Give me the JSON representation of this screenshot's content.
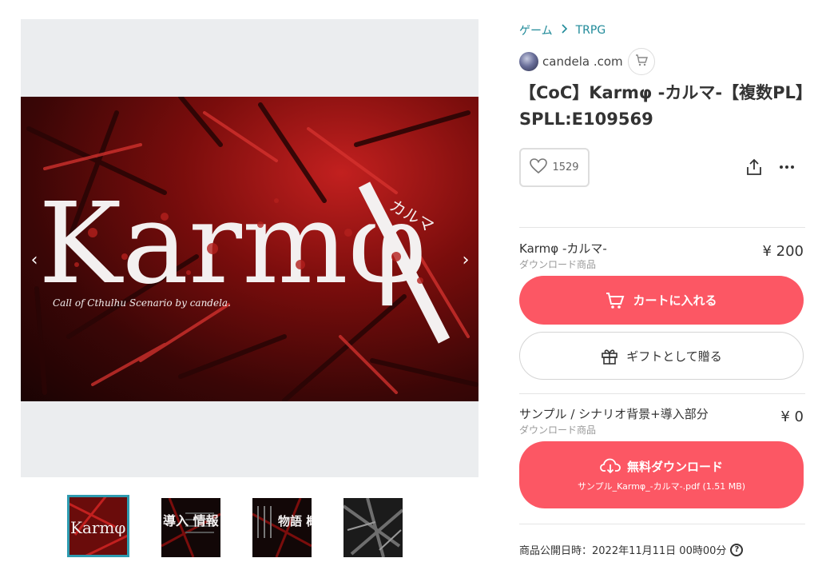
{
  "breadcrumb": {
    "category": "ゲーム",
    "subcategory": "TRPG"
  },
  "shop": {
    "name": "candela .com",
    "icon": "cart-icon"
  },
  "product": {
    "title": "【CoC】Karmφ -カルマ-【複数PL】SPLL:E109569",
    "likes": "1529"
  },
  "hero": {
    "logo_text": "Karmφ",
    "kana": "カルマ",
    "subtitle": "Call of Cthulhu Scenario by candela."
  },
  "gallery": {
    "prev_icon": "chevron-left-icon",
    "next_icon": "chevron-right-icon",
    "thumbnails": [
      {
        "caption": "Karmφ"
      },
      {
        "caption": "導入 情報"
      },
      {
        "caption": "物語 概要"
      },
      {
        "caption": ""
      }
    ]
  },
  "items": [
    {
      "name": "Karmφ -カルマ-",
      "type": "ダウンロード商品",
      "price": "¥ 200",
      "cart_label": "カートに入れる",
      "gift_label": "ギフトとして贈る"
    },
    {
      "name": "サンプル / シナリオ背景+導入部分",
      "type": "ダウンロード商品",
      "price": "¥ 0",
      "download_label": "無料ダウンロード",
      "file_label": "サンプル_Karmφ_-カルマ-.pdf (1.51 MB)"
    }
  ],
  "published": "商品公開日時：2022年11月11日 00時00分",
  "colors": {
    "accent": "#fc5764",
    "link": "#1f8a99",
    "thumb_active": "#2e9bb0"
  }
}
